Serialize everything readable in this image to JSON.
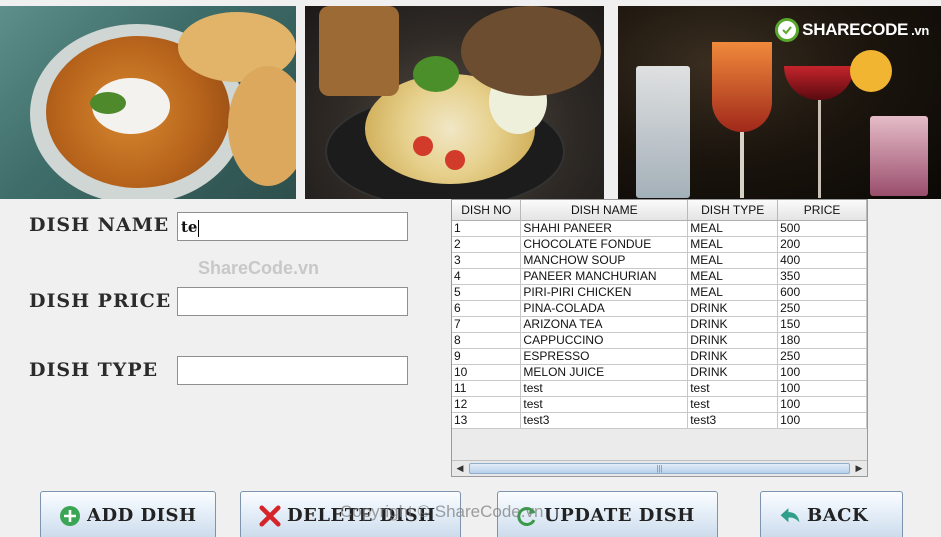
{
  "logo": {
    "brand": "SHARECODE",
    "domain": ".vn",
    "color": "#5aa72e"
  },
  "watermark_mid": "ShareCode.vn",
  "footer_watermark": "Copyright © ShareCode.vn",
  "form": {
    "dish_name_label": "DISH NAME",
    "dish_name_value": "te",
    "dish_price_label": "DISH PRICE",
    "dish_price_value": "",
    "dish_type_label": "DISH TYPE",
    "dish_type_value": ""
  },
  "table": {
    "headers": [
      "DISH NO",
      "DISH NAME",
      "DISH TYPE",
      "PRICE"
    ],
    "rows": [
      [
        "1",
        "SHAHI PANEER",
        "MEAL",
        "500"
      ],
      [
        "2",
        "CHOCOLATE FONDUE",
        "MEAL",
        "200"
      ],
      [
        "3",
        "MANCHOW SOUP",
        "MEAL",
        "400"
      ],
      [
        "4",
        "PANEER MANCHURIAN",
        "MEAL",
        "350"
      ],
      [
        "5",
        "PIRI-PIRI CHICKEN",
        "MEAL",
        "600"
      ],
      [
        "6",
        "PINA-COLADA",
        "DRINK",
        "250"
      ],
      [
        "7",
        "ARIZONA TEA",
        "DRINK",
        "150"
      ],
      [
        "8",
        "CAPPUCCINO",
        "DRINK",
        "180"
      ],
      [
        "9",
        "ESPRESSO",
        "DRINK",
        "250"
      ],
      [
        "10",
        "MELON JUICE",
        "DRINK",
        "100"
      ],
      [
        "11",
        "test",
        "test",
        "100"
      ],
      [
        "12",
        "test",
        "test",
        "100"
      ],
      [
        "13",
        "test3",
        "test3",
        "100"
      ]
    ]
  },
  "buttons": {
    "add": "ADD DISH",
    "delete": "DELETE DISH",
    "update": "UPDATE DISH",
    "back": "BACK"
  },
  "icons": {
    "add": "plus-circle-icon",
    "delete": "red-x-icon",
    "update": "refresh-icon",
    "back": "back-arrow-icon"
  },
  "colors": {
    "add_icon": "#3aa655",
    "delete_icon": "#d6252a",
    "update_icon": "#3a9a4a",
    "back_icon": "#2f9e8a"
  }
}
